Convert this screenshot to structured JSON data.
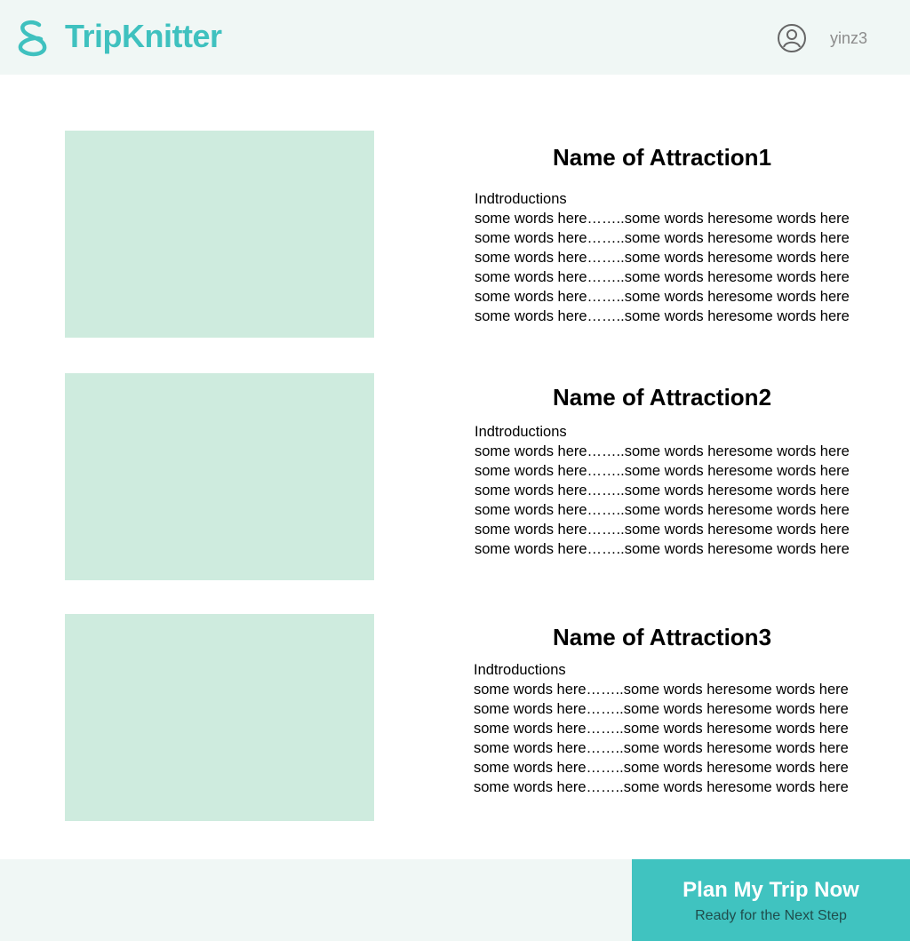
{
  "header": {
    "brand": "TripKnitter",
    "logo_icon": "knot-s-logo-icon",
    "user_icon": "user-circle-icon",
    "username": "yinz3"
  },
  "attractions": [
    {
      "title": "Name of Attraction1",
      "intro": "Indtroductions",
      "lines": [
        "some words here……..some words heresome words here",
        "some words here……..some words heresome words here",
        "some words here……..some words heresome words here",
        "some words here……..some words heresome words here",
        "some words here……..some words heresome words here",
        "some words here……..some words heresome words here"
      ]
    },
    {
      "title": "Name of Attraction2",
      "intro": "Indtroductions",
      "lines": [
        "some words here……..some words heresome words here",
        "some words here……..some words heresome words here",
        "some words here……..some words heresome words here",
        "some words here……..some words heresome words here",
        "some words here……..some words heresome words here",
        "some words here……..some words heresome words here"
      ]
    },
    {
      "title": "Name of Attraction3",
      "intro": "Indtroductions",
      "lines": [
        "some words here……..some words heresome words here",
        "some words here……..some words heresome words here",
        "some words here……..some words heresome words here",
        "some words here……..some words heresome words here",
        "some words here……..some words heresome words here",
        "some words here……..some words heresome words here"
      ]
    }
  ],
  "cta": {
    "title": "Plan My Trip Now",
    "subtitle": "Ready for the Next Step"
  },
  "colors": {
    "brand": "#3fc1bf",
    "header_bg": "#f0f7f5",
    "image_placeholder": "#ceebde",
    "cta_bg": "#40c3c0"
  }
}
